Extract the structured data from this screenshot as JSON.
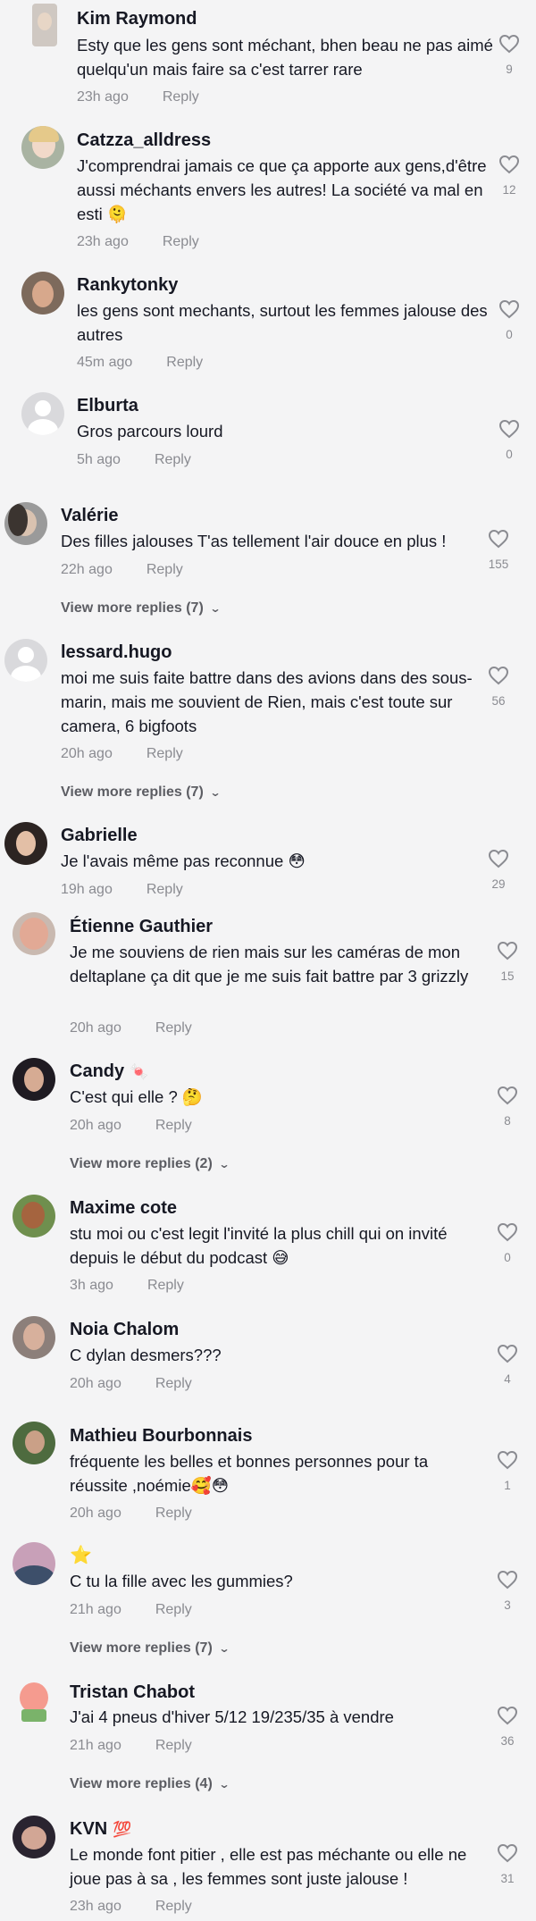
{
  "icons": {
    "like": "heart-outline-icon",
    "expand": "chevron-down-icon"
  },
  "comments": [
    {
      "name": "Kim Raymond",
      "text": "Esty que les gens sont méchant, bhen beau ne pas aimé quelqu'un mais faire sa c'est tarrer rare",
      "time": "23h ago",
      "reply": "Reply",
      "likes": "9"
    },
    {
      "name": "Catzza_alldress",
      "text": "J'comprendrai jamais ce que ça apporte aux gens,d'être aussi méchants envers les autres! La société va mal en esti 🫠",
      "time": "23h ago",
      "reply": "Reply",
      "likes": "12"
    },
    {
      "name": "Rankytonky",
      "text": "les gens sont mechants, surtout les femmes jalouse des autres",
      "time": "45m ago",
      "reply": "Reply",
      "likes": "0"
    },
    {
      "name": "Elburta",
      "text": "Gros parcours lourd",
      "time": "5h ago",
      "reply": "Reply",
      "likes": "0"
    },
    {
      "name": "Valérie",
      "text": "Des filles jalouses T'as tellement l'air douce en plus !",
      "time": "22h ago",
      "reply": "Reply",
      "likes": "155",
      "more": "View more replies (7)"
    },
    {
      "name": "lessard.hugo",
      "text": "moi me suis faite battre dans des avions dans des sous-marin, mais me souvient de Rien, mais c'est toute sur camera, 6 bigfoots",
      "time": "20h ago",
      "reply": "Reply",
      "likes": "56",
      "more": "View more replies (7)"
    },
    {
      "name": "Gabrielle",
      "text": "Je l'avais même pas reconnue 😳",
      "time": "19h ago",
      "reply": "Reply",
      "likes": "29"
    },
    {
      "name": "Étienne Gauthier",
      "text": "Je me souviens de rien mais sur les caméras de mon deltaplane ça dit que je me suis fait battre par 3 grizzly",
      "time": "20h ago",
      "reply": "Reply",
      "likes": "15"
    },
    {
      "name": "Candy",
      "badge": "🍬",
      "text": "C'est qui elle ? 🤔",
      "time": "20h ago",
      "reply": "Reply",
      "likes": "8",
      "more": "View more replies (2)"
    },
    {
      "name": "Maxime cote",
      "text": "stu moi ou c'est legit l'invité la plus chill qui on invité depuis le début du podcast 😅",
      "time": "3h ago",
      "reply": "Reply",
      "likes": "0"
    },
    {
      "name": "Noia Chalom",
      "text": "C dylan desmers???",
      "time": "20h ago",
      "reply": "Reply",
      "likes": "4"
    },
    {
      "name": "Mathieu Bourbonnais",
      "text": "fréquente les belles et bonnes personnes pour ta réussite ,noémie🥰😳",
      "time": "20h ago",
      "reply": "Reply",
      "likes": "1"
    },
    {
      "name": "⭐",
      "text": "C tu la fille avec les gummies?",
      "time": "21h ago",
      "reply": "Reply",
      "likes": "3",
      "more": "View more replies (7)"
    },
    {
      "name": "Tristan Chabot",
      "text": "J'ai 4 pneus d'hiver 5/12 19/235/35 à vendre",
      "time": "21h ago",
      "reply": "Reply",
      "likes": "36",
      "more": "View more replies (4)"
    },
    {
      "name": "KVN",
      "badge": "💯",
      "text": "Le monde font pitier , elle est pas méchante ou elle ne joue pas à sa , les femmes sont juste jalouse !",
      "time": "23h ago",
      "reply": "Reply",
      "likes": "31"
    }
  ]
}
